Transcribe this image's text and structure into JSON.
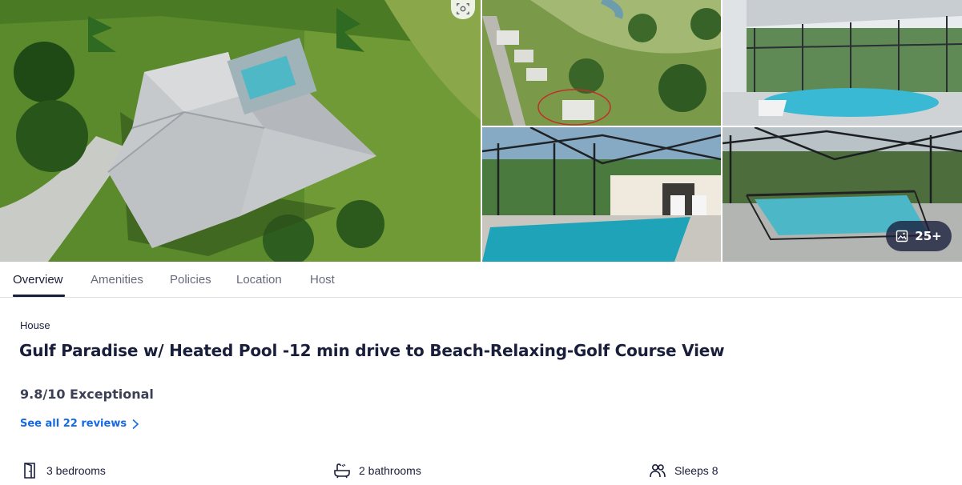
{
  "gallery": {
    "photo_count_label": "25+",
    "icons": {
      "lens": "visual-search-icon",
      "photos": "photo-stack-icon"
    }
  },
  "tabs": [
    {
      "label": "Overview",
      "active": true
    },
    {
      "label": "Amenities",
      "active": false
    },
    {
      "label": "Policies",
      "active": false
    },
    {
      "label": "Location",
      "active": false
    },
    {
      "label": "Host",
      "active": false
    }
  ],
  "listing": {
    "type": "House",
    "title": "Gulf Paradise w/ Heated Pool -12 min drive to Beach-Relaxing-Golf Course View",
    "rating": "9.8/10 Exceptional",
    "reviews_link": "See all 22 reviews"
  },
  "facts": {
    "bedrooms": "3 bedrooms",
    "bathrooms": "2 bathrooms",
    "sleeps": "Sleeps 8"
  },
  "colors": {
    "text": "#191e3b",
    "link": "#1668e3",
    "muted": "#676a7d",
    "divider": "#dfe0e4"
  }
}
